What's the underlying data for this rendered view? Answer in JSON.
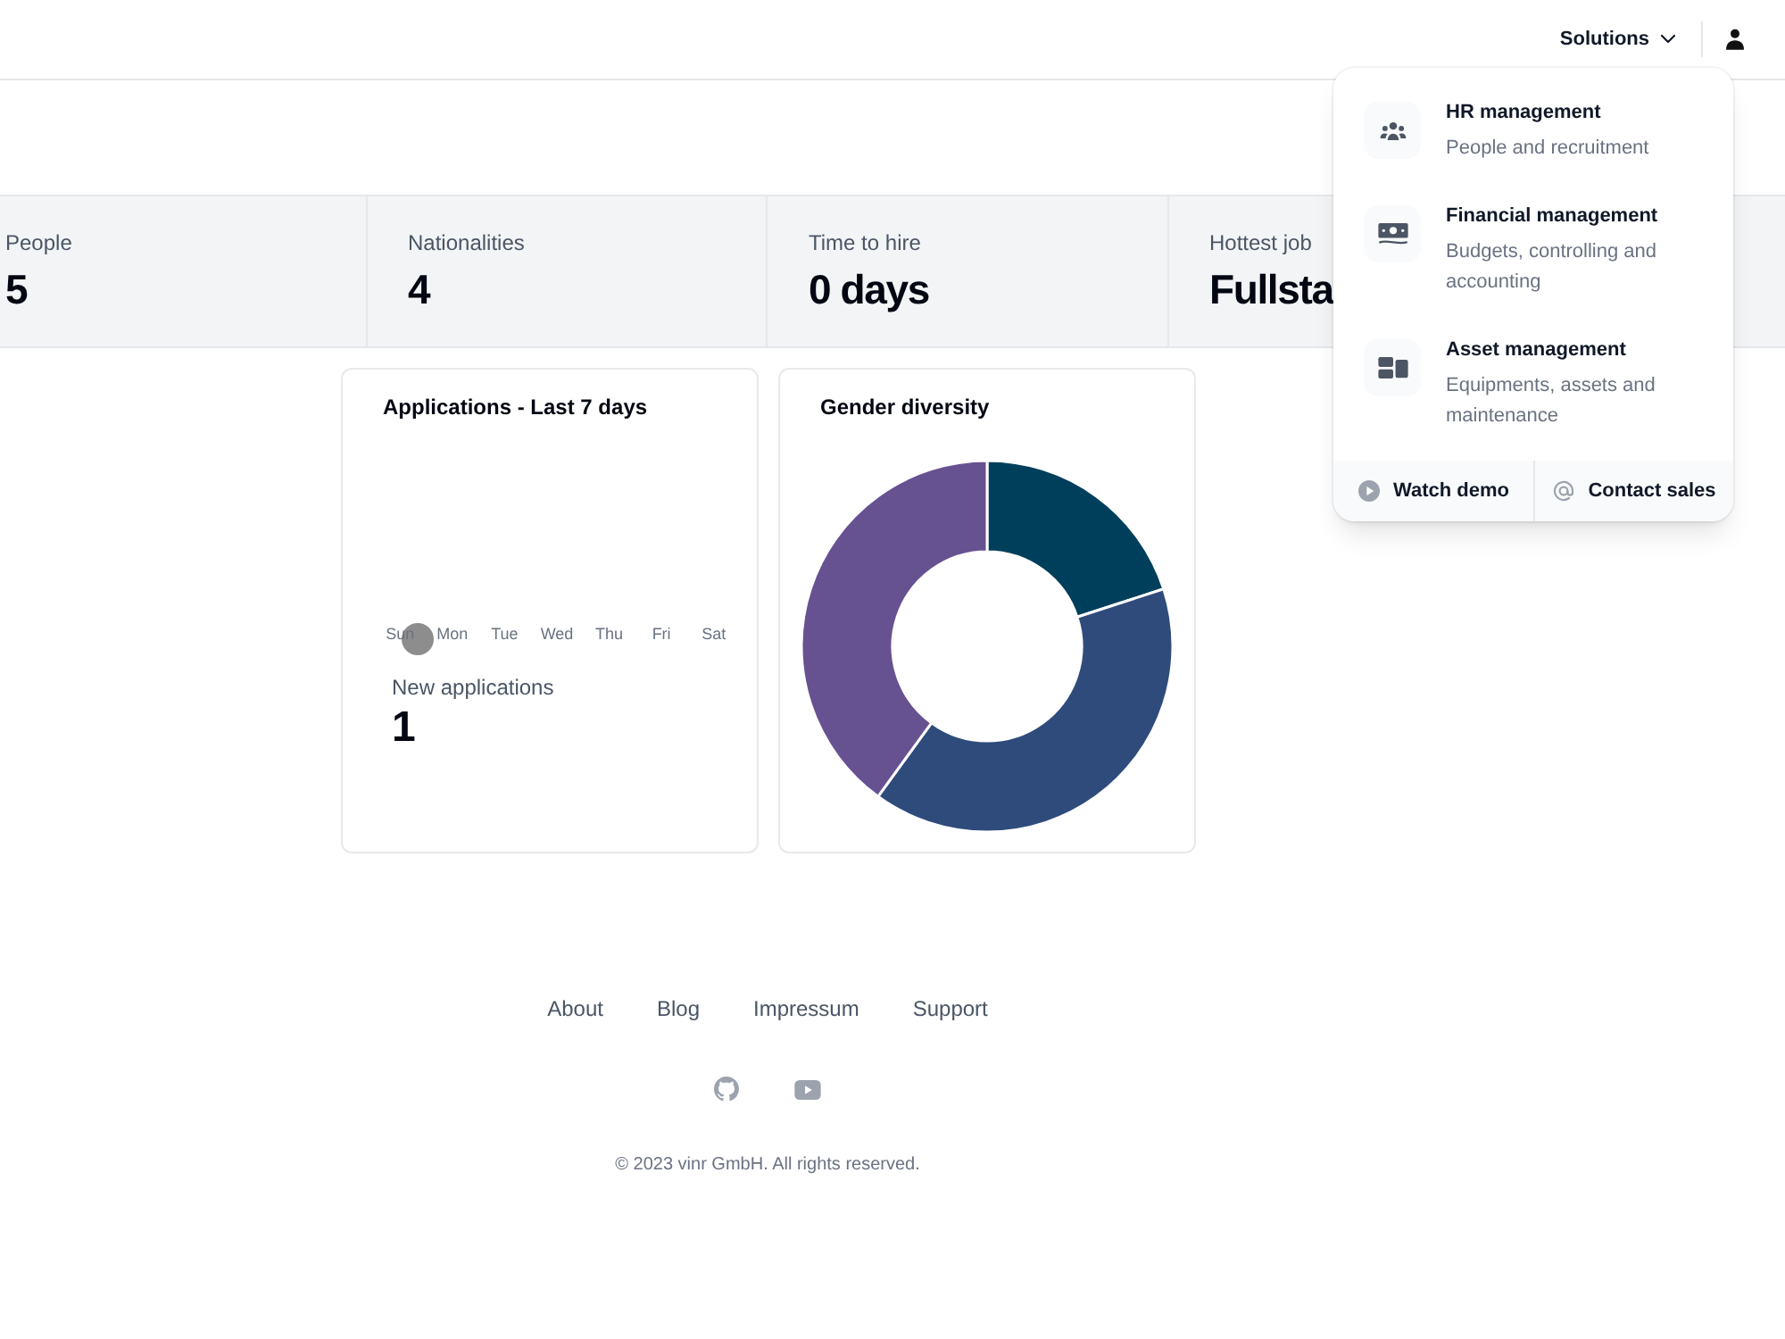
{
  "nav": {
    "menu_label": "Solutions"
  },
  "stats": [
    {
      "label": "People",
      "value": "5"
    },
    {
      "label": "Nationalities",
      "value": "4"
    },
    {
      "label": "Time to hire",
      "value": "0 days"
    },
    {
      "label": "Hottest job",
      "value": "Fullsta"
    }
  ],
  "dropdown": {
    "items": [
      {
        "title": "HR management",
        "description": "People and recruitment"
      },
      {
        "title": "Financial management",
        "description": "Budgets, controlling and accounting"
      },
      {
        "title": "Asset management",
        "description": "Equipments, assets and maintenance"
      }
    ],
    "actions": [
      {
        "label": "Watch demo"
      },
      {
        "label": "Contact sales"
      }
    ]
  },
  "cards": [
    {
      "kind": "applications",
      "title": "Applications - Last 7 days",
      "days": [
        "Sun",
        "Mon",
        "Tue",
        "Wed",
        "Thu",
        "Fri",
        "Sat"
      ],
      "metric_label": "New applications",
      "metric_value": "1"
    },
    {
      "kind": "donut",
      "title": "Gender diversity"
    }
  ],
  "footer": {
    "links": [
      "About",
      "Blog",
      "Impressum",
      "Support"
    ],
    "copyright": "© 2023 vinr GmbH. All rights reserved."
  }
}
